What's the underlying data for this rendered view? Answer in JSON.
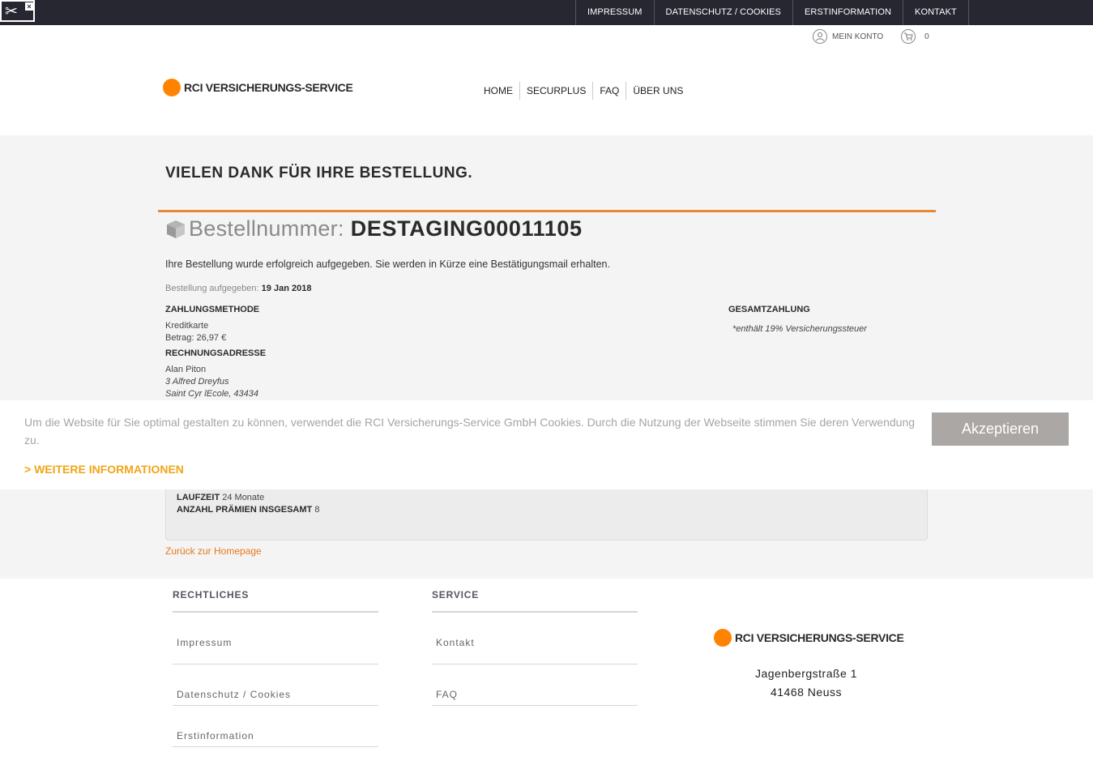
{
  "topbar": {
    "links": [
      "IMPRESSUM",
      "DATENSCHUTZ / COOKIES",
      "ERSTINFORMATION",
      "KONTAKT"
    ]
  },
  "account": {
    "label": "MEIN KONTO",
    "cart_count": "0"
  },
  "brand": {
    "name": "RCI VERSICHERUNGS-SERVICE",
    "color": "#ff8300"
  },
  "nav": {
    "items": [
      "HOME",
      "SECURPLUS",
      "FAQ",
      "ÜBER UNS"
    ]
  },
  "order": {
    "thanks": "VIELEN DANK FÜR IHRE BESTELLUNG.",
    "number_label": "Bestellnummer:",
    "number": "DESTAGING00011105",
    "success_msg": "Ihre Bestellung wurde erfolgreich aufgegeben. Sie werden in Kürze eine Bestätigungsmail erhalten.",
    "placed_label": "Bestellung aufgegeben:",
    "placed_date": "19 Jan 2018",
    "payment_heading": "ZAHLUNGSMETHODE",
    "payment_method": "Kreditkarte",
    "payment_amount": "Betrag: 26,97 €",
    "billing_heading": "RECHNUNGSADRESSE",
    "billing_name": "Alan Piton",
    "billing_street": "3 Alfred Dreyfus",
    "billing_city": "Saint Cyr lEcole, 43434",
    "total_heading": "GESAMTZAHLUNG",
    "tax_note": "*enthält 19% Versicherungssteuer",
    "term_label": "LAUFZEIT",
    "term_value": "24 Monate",
    "premiums_label": "ANZAHL PRÄMIEN INSGESAMT",
    "premiums_value": "8",
    "back_link": "Zurück zur Homepage"
  },
  "cookie": {
    "text": "Um die Website für Sie optimal gestalten zu können, verwendet die RCI Versicherungs-Service GmbH Cookies. Durch die Nutzung der Webseite stimmen Sie deren Verwendung zu.",
    "more": "> WEITERE INFORMATIONEN",
    "accept": "Akzeptieren"
  },
  "footer": {
    "legal_heading": "RECHTLICHES",
    "legal_links": [
      "Impressum",
      "Datenschutz / Cookies",
      "Erstinformation"
    ],
    "service_heading": "SERVICE",
    "service_links": [
      "Kontakt",
      "FAQ"
    ],
    "address_street": "Jagenbergstraße 1",
    "address_city": "41468 Neuss"
  }
}
